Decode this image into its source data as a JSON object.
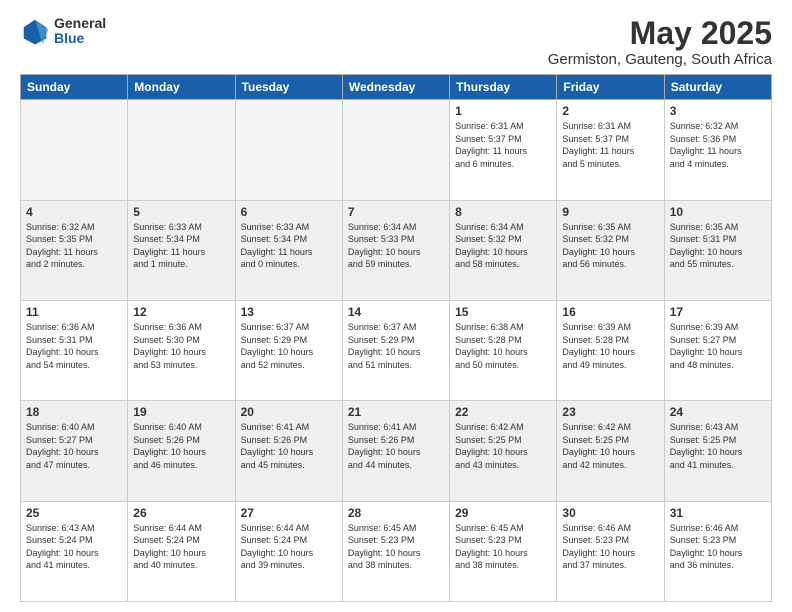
{
  "logo": {
    "general": "General",
    "blue": "Blue"
  },
  "header": {
    "title": "May 2025",
    "subtitle": "Germiston, Gauteng, South Africa"
  },
  "columns": [
    "Sunday",
    "Monday",
    "Tuesday",
    "Wednesday",
    "Thursday",
    "Friday",
    "Saturday"
  ],
  "weeks": [
    {
      "alt": false,
      "days": [
        {
          "num": "",
          "info": ""
        },
        {
          "num": "",
          "info": ""
        },
        {
          "num": "",
          "info": ""
        },
        {
          "num": "",
          "info": ""
        },
        {
          "num": "1",
          "info": "Sunrise: 6:31 AM\nSunset: 5:37 PM\nDaylight: 11 hours\nand 6 minutes."
        },
        {
          "num": "2",
          "info": "Sunrise: 6:31 AM\nSunset: 5:37 PM\nDaylight: 11 hours\nand 5 minutes."
        },
        {
          "num": "3",
          "info": "Sunrise: 6:32 AM\nSunset: 5:36 PM\nDaylight: 11 hours\nand 4 minutes."
        }
      ]
    },
    {
      "alt": true,
      "days": [
        {
          "num": "4",
          "info": "Sunrise: 6:32 AM\nSunset: 5:35 PM\nDaylight: 11 hours\nand 2 minutes."
        },
        {
          "num": "5",
          "info": "Sunrise: 6:33 AM\nSunset: 5:34 PM\nDaylight: 11 hours\nand 1 minute."
        },
        {
          "num": "6",
          "info": "Sunrise: 6:33 AM\nSunset: 5:34 PM\nDaylight: 11 hours\nand 0 minutes."
        },
        {
          "num": "7",
          "info": "Sunrise: 6:34 AM\nSunset: 5:33 PM\nDaylight: 10 hours\nand 59 minutes."
        },
        {
          "num": "8",
          "info": "Sunrise: 6:34 AM\nSunset: 5:32 PM\nDaylight: 10 hours\nand 58 minutes."
        },
        {
          "num": "9",
          "info": "Sunrise: 6:35 AM\nSunset: 5:32 PM\nDaylight: 10 hours\nand 56 minutes."
        },
        {
          "num": "10",
          "info": "Sunrise: 6:35 AM\nSunset: 5:31 PM\nDaylight: 10 hours\nand 55 minutes."
        }
      ]
    },
    {
      "alt": false,
      "days": [
        {
          "num": "11",
          "info": "Sunrise: 6:36 AM\nSunset: 5:31 PM\nDaylight: 10 hours\nand 54 minutes."
        },
        {
          "num": "12",
          "info": "Sunrise: 6:36 AM\nSunset: 5:30 PM\nDaylight: 10 hours\nand 53 minutes."
        },
        {
          "num": "13",
          "info": "Sunrise: 6:37 AM\nSunset: 5:29 PM\nDaylight: 10 hours\nand 52 minutes."
        },
        {
          "num": "14",
          "info": "Sunrise: 6:37 AM\nSunset: 5:29 PM\nDaylight: 10 hours\nand 51 minutes."
        },
        {
          "num": "15",
          "info": "Sunrise: 6:38 AM\nSunset: 5:28 PM\nDaylight: 10 hours\nand 50 minutes."
        },
        {
          "num": "16",
          "info": "Sunrise: 6:39 AM\nSunset: 5:28 PM\nDaylight: 10 hours\nand 49 minutes."
        },
        {
          "num": "17",
          "info": "Sunrise: 6:39 AM\nSunset: 5:27 PM\nDaylight: 10 hours\nand 48 minutes."
        }
      ]
    },
    {
      "alt": true,
      "days": [
        {
          "num": "18",
          "info": "Sunrise: 6:40 AM\nSunset: 5:27 PM\nDaylight: 10 hours\nand 47 minutes."
        },
        {
          "num": "19",
          "info": "Sunrise: 6:40 AM\nSunset: 5:26 PM\nDaylight: 10 hours\nand 46 minutes."
        },
        {
          "num": "20",
          "info": "Sunrise: 6:41 AM\nSunset: 5:26 PM\nDaylight: 10 hours\nand 45 minutes."
        },
        {
          "num": "21",
          "info": "Sunrise: 6:41 AM\nSunset: 5:26 PM\nDaylight: 10 hours\nand 44 minutes."
        },
        {
          "num": "22",
          "info": "Sunrise: 6:42 AM\nSunset: 5:25 PM\nDaylight: 10 hours\nand 43 minutes."
        },
        {
          "num": "23",
          "info": "Sunrise: 6:42 AM\nSunset: 5:25 PM\nDaylight: 10 hours\nand 42 minutes."
        },
        {
          "num": "24",
          "info": "Sunrise: 6:43 AM\nSunset: 5:25 PM\nDaylight: 10 hours\nand 41 minutes."
        }
      ]
    },
    {
      "alt": false,
      "days": [
        {
          "num": "25",
          "info": "Sunrise: 6:43 AM\nSunset: 5:24 PM\nDaylight: 10 hours\nand 41 minutes."
        },
        {
          "num": "26",
          "info": "Sunrise: 6:44 AM\nSunset: 5:24 PM\nDaylight: 10 hours\nand 40 minutes."
        },
        {
          "num": "27",
          "info": "Sunrise: 6:44 AM\nSunset: 5:24 PM\nDaylight: 10 hours\nand 39 minutes."
        },
        {
          "num": "28",
          "info": "Sunrise: 6:45 AM\nSunset: 5:23 PM\nDaylight: 10 hours\nand 38 minutes."
        },
        {
          "num": "29",
          "info": "Sunrise: 6:45 AM\nSunset: 5:23 PM\nDaylight: 10 hours\nand 38 minutes."
        },
        {
          "num": "30",
          "info": "Sunrise: 6:46 AM\nSunset: 5:23 PM\nDaylight: 10 hours\nand 37 minutes."
        },
        {
          "num": "31",
          "info": "Sunrise: 6:46 AM\nSunset: 5:23 PM\nDaylight: 10 hours\nand 36 minutes."
        }
      ]
    }
  ]
}
